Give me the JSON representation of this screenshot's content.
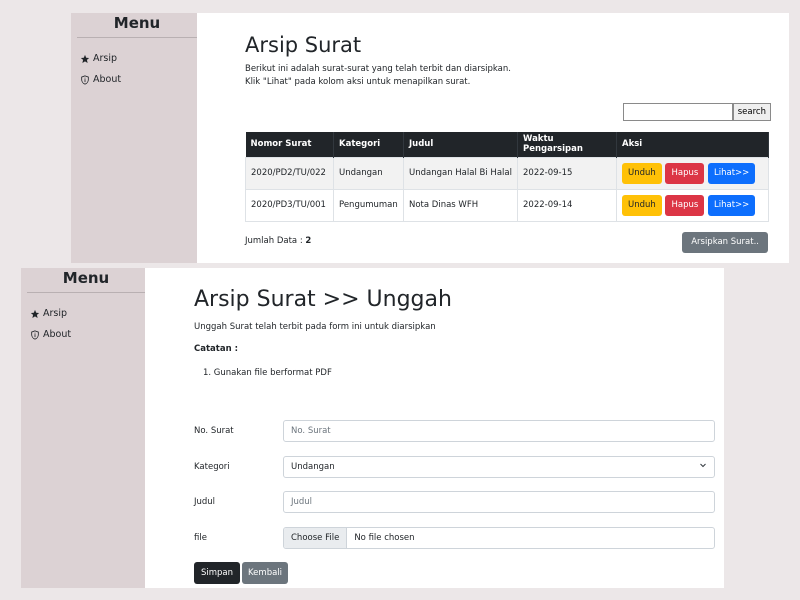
{
  "panel1": {
    "sidebar": {
      "title": "Menu",
      "items": [
        {
          "icon": "star-icon",
          "label": "Arsip"
        },
        {
          "icon": "info-shield-icon",
          "label": "About"
        }
      ]
    },
    "title": "Arsip Surat",
    "desc_line1": "Berikut ini adalah surat-surat yang telah terbit dan diarsipkan.",
    "desc_line2": "Klik \"Lihat\" pada kolom aksi untuk menapilkan surat.",
    "search": {
      "value": "",
      "button": "search"
    },
    "table": {
      "headers": [
        "Nomor Surat",
        "Kategori",
        "Judul",
        "Waktu Pengarsipan",
        "Aksi"
      ],
      "rows": [
        {
          "nomor": "2020/PD2/TU/022",
          "kategori": "Undangan",
          "judul": "Undangan Halal Bi Halal",
          "waktu": "2022-09-15"
        },
        {
          "nomor": "2020/PD3/TU/001",
          "kategori": "Pengumuman",
          "judul": "Nota Dinas WFH",
          "waktu": "2022-09-14"
        }
      ],
      "actions": {
        "unduh": "Unduh",
        "hapus": "Hapus",
        "lihat": "Lihat>>"
      }
    },
    "jumlah_label": "Jumlah Data : ",
    "jumlah_value": "2",
    "arsipkan_button": "Arsipkan Surat.."
  },
  "panel2": {
    "sidebar": {
      "title": "Menu",
      "items": [
        {
          "icon": "star-icon",
          "label": "Arsip"
        },
        {
          "icon": "info-shield-icon",
          "label": "About"
        }
      ]
    },
    "title": "Arsip Surat >> Unggah",
    "subtitle": "Unggah Surat telah terbit pada form ini untuk diarsipkan",
    "catatan_label": "Catatan :",
    "notes": [
      "1. Gunakan file berformat PDF"
    ],
    "form": {
      "no_surat": {
        "label": "No. Surat",
        "placeholder": "No. Surat"
      },
      "kategori": {
        "label": "Kategori",
        "selected": "Undangan"
      },
      "judul": {
        "label": "Judul",
        "placeholder": "Judul"
      },
      "file": {
        "label": "file",
        "button": "Choose File",
        "status": "No file chosen"
      }
    },
    "simpan_button": "Simpan",
    "kembali_button": "Kembali"
  },
  "colors": {
    "sidebar_bg": "#dcd2d4",
    "table_header": "#212529",
    "warning": "#ffc107",
    "danger": "#dc3545",
    "primary": "#0d6efd",
    "secondary": "#6c757d"
  }
}
